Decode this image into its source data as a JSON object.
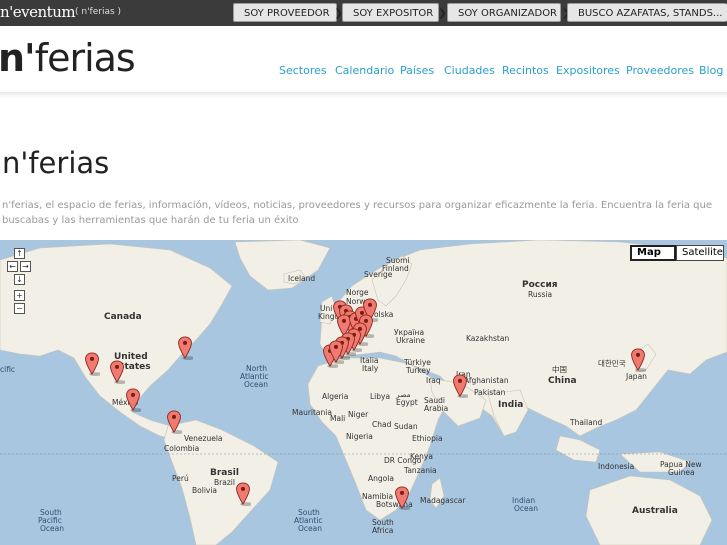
{
  "topbar": {
    "brand": "n'eventum",
    "sub": "( n'ferias )",
    "buttons": [
      "SOY PROVEEDOR",
      "SOY EXPOSITOR",
      "SOY ORGANIZADOR",
      "BUSCO AZAFATAS, STANDS..."
    ]
  },
  "header": {
    "logo_n": "n'",
    "logo_rest": "ferias",
    "nav": [
      "Sectores",
      "Calendario",
      "Países",
      "Ciudades",
      "Recintos",
      "Expositores",
      "Proveedores",
      "Blog"
    ]
  },
  "main": {
    "title": "n'ferias",
    "description": "n'ferias, el espacio de ferias, información, vídeos, noticias, proveedores y recursos para organizar eficazmente la feria. Encuentra la feria que buscabas y las herramientas que harán de tu feria un éxito"
  },
  "map": {
    "types": [
      "Map",
      "Satellite"
    ],
    "selected_type": "Map",
    "labels": {
      "canada": "Canada",
      "united_states_1": "United",
      "united_states_2": "States",
      "mexico": "México",
      "north_atlantic_1": "North",
      "north_atlantic_2": "Atlantic",
      "north_atlantic_3": "Ocean",
      "pacific": "cific",
      "iceland": "Iceland",
      "suomi": "Suomi",
      "finland": "Finland",
      "sverige": "Sverige",
      "norge": "Norge",
      "norway": "Norway",
      "polska": "olska",
      "ukraina": "Україна",
      "ukraine": "Ukraine",
      "russia_ru": "Россия",
      "russia": "Russia",
      "kazakhstan": "Kazakhstan",
      "turkiye": "Türkiye",
      "turkey": "Turkey",
      "italia": "Italia",
      "italy": "Italy",
      "iraq": "Iraq",
      "iran": "Iran",
      "afghanistan": "Afghanistan",
      "pakistan": "Pakistan",
      "india": "India",
      "egypt_ar": "مصر",
      "egypt": "Egypt",
      "libya": "Libya",
      "algeria": "Algeria",
      "mali": "Mali",
      "niger": "Niger",
      "chad": "Chad",
      "sudan": "Sudan",
      "nigeria": "Nigeria",
      "mauritania": "Mauritania",
      "ethiopia": "Ethiopia",
      "saudi_1": "Saudi",
      "saudi_2": "Arabia",
      "drc": "DR Congo",
      "kenya": "Kenya",
      "tanzania": "Tanzania",
      "angola": "Angola",
      "namibia": "Namibia",
      "botswana": "Botswana",
      "south_africa_1": "South",
      "south_africa_2": "Africa",
      "madagascar": "Madagascar",
      "china_zh": "中国",
      "china": "China",
      "korea": "대한민국",
      "japan": "Japan",
      "thailand": "Thailand",
      "venezuela": "Venezuela",
      "colombia": "Colombia",
      "peru": "Perú",
      "bolivia": "Bolivia",
      "brasil": "Brasil",
      "brazil": "Brazil",
      "south_pacific_1": "South",
      "south_pacific_2": "Pacific",
      "south_pacific_3": "Ocean",
      "south_atlantic_1": "South",
      "south_atlantic_2": "Atlantic",
      "south_atlantic_3": "Ocean",
      "indian_1": "Indian",
      "indian_2": "Ocean",
      "papua_1": "Papua New",
      "papua_2": "Guinea",
      "indonesia": "Indonesia",
      "australia": "Australia",
      "uk_1": "Uni",
      "uk_2": "Kingdo"
    },
    "controls": [
      "↑",
      "←",
      "→",
      "↓",
      "+",
      "−"
    ]
  }
}
